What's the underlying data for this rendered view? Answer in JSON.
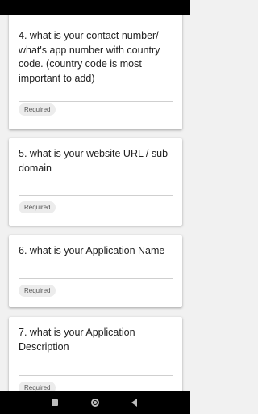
{
  "questions": [
    {
      "title": "4. what is your contact number/ what's app number with country code. (country code is most important to add)",
      "badge": "Required"
    },
    {
      "title": "5. what is your website URL / sub domain",
      "badge": "Required"
    },
    {
      "title": "6. what is your Application Name",
      "badge": "Required"
    },
    {
      "title": "7. what is your Application Description",
      "badge": "Required"
    }
  ],
  "nav": {
    "recents_icon": "square-icon",
    "home_icon": "circle-icon",
    "back_icon": "triangle-back-icon"
  },
  "colors": {
    "background": "#f1f1f1",
    "card": "#ffffff",
    "chip": "#ececec",
    "system_bars": "#000000"
  }
}
